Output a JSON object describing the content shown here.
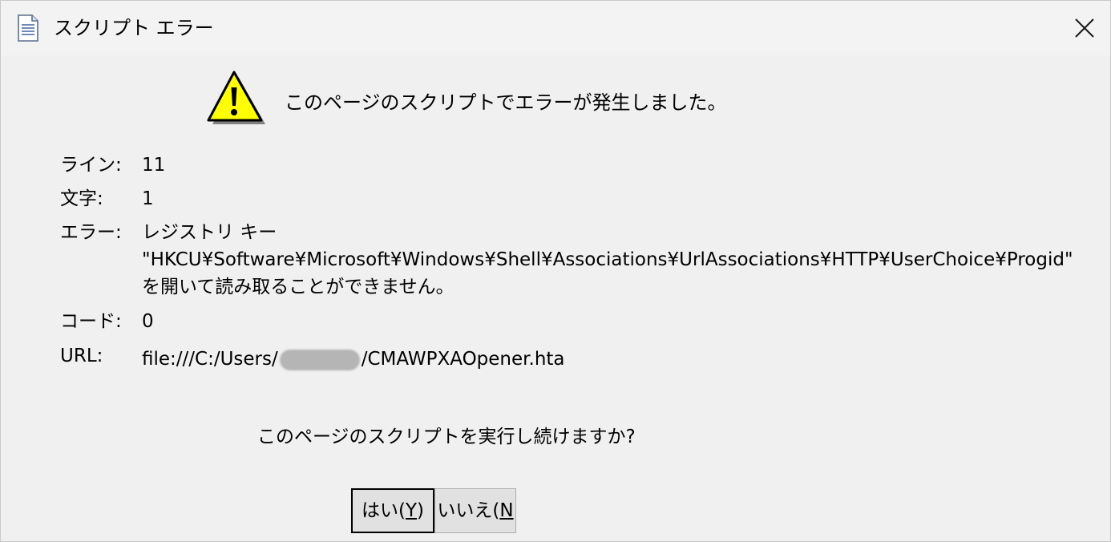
{
  "window": {
    "title": "スクリプト エラー",
    "close_label": "✕"
  },
  "dialog": {
    "message": "このページのスクリプトでエラーが発生しました。",
    "fields": {
      "line_label": "ライン:",
      "line_value": "11",
      "char_label": "文字:",
      "char_value": "1",
      "error_label": "エラー:",
      "error_line1": "レジストリ キー",
      "error_line2": "\"HKCU¥Software¥Microsoft¥Windows¥Shell¥Associations¥UrlAssociations¥HTTP¥UserChoice¥Progid\"",
      "error_line3": "を開いて読み取ることができません。",
      "code_label": "コード:",
      "code_value": "0",
      "url_label": "URL:",
      "url_prefix": "file:///C:/Users/",
      "url_suffix": "/CMAWPXAOpener.hta"
    },
    "question": "このページのスクリプトを実行し続けますか?",
    "buttons": {
      "yes_text": "はい(",
      "yes_key": "Y",
      "yes_close": ")",
      "no_text": "いいえ(",
      "no_key": "N"
    }
  },
  "colors": {
    "window_bg": "#f0f0f0",
    "warning_yellow": "#ffff00",
    "button_bg": "#e1e1e1"
  },
  "icons": {
    "title": "document-icon",
    "warning": "warning-icon",
    "close": "close-icon"
  }
}
